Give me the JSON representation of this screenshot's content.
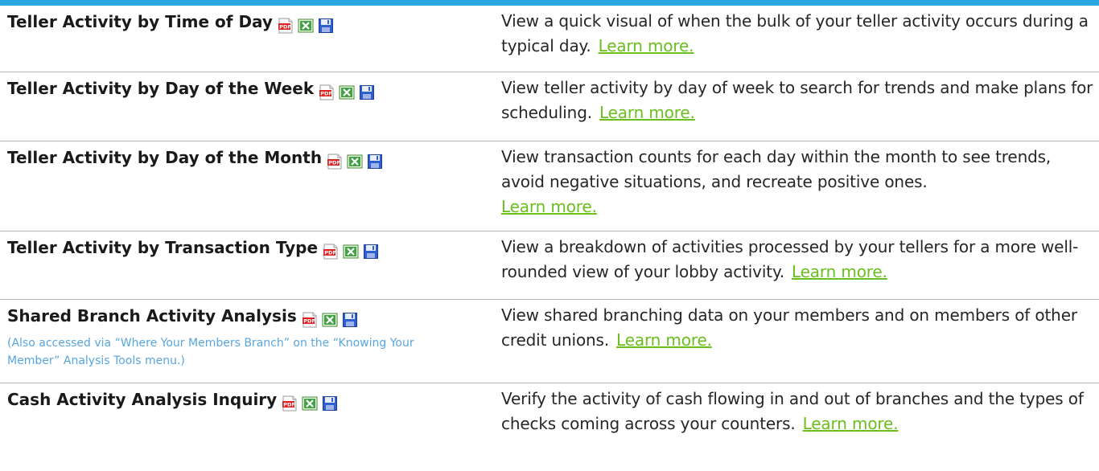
{
  "colors": {
    "top_bar": "#2aa6e0",
    "link": "#6abf1e",
    "note": "#58a6e0",
    "divider": "#b3b3b3"
  },
  "icons": [
    "pdf-icon",
    "excel-icon",
    "save-icon"
  ],
  "rows": [
    {
      "title": "Teller Activity by Time of Day",
      "description": "View a quick visual of when the bulk of your teller activity occurs during a typical day.",
      "link": "Learn more."
    },
    {
      "title": "Teller Activity by Day of the Week",
      "description": "View teller activity by day of week to search for trends and make plans for scheduling.",
      "link": "Learn more."
    },
    {
      "title": "Teller Activity by Day of the Month",
      "description": "View transaction counts for each day within the month to see trends, avoid negative situations, and recreate positive ones.",
      "link": "Learn more."
    },
    {
      "title": "Teller Activity by Transaction Type",
      "description": "View a breakdown of activities processed by your tellers for a more well-rounded view of your lobby activity.",
      "link": "Learn more."
    },
    {
      "title": "Shared Branch Activity Analysis",
      "note": "(Also accessed via “Where Your Members Branch” on the “Knowing Your Member” Analysis Tools menu.)",
      "description": "View shared branching data on your members and on members of other credit unions.",
      "link": "Learn more."
    },
    {
      "title": "Cash Activity Analysis Inquiry",
      "description": "Verify the activity of cash flowing in and out of branches and the types of checks coming across your counters.",
      "link": "Learn more."
    }
  ]
}
